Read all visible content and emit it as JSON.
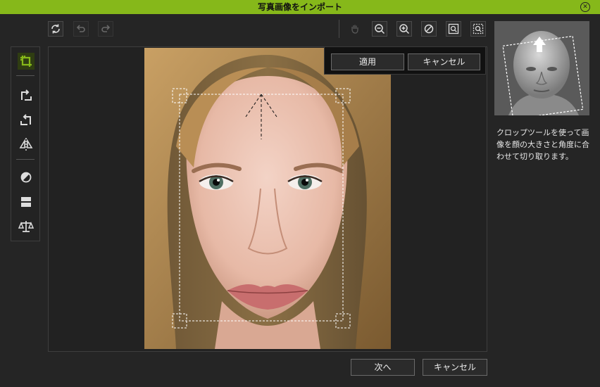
{
  "window": {
    "title": "写真画像をインポート",
    "close_icon": "close-icon"
  },
  "toolbar": {
    "left_icons": [
      "reset-icon",
      "undo-icon",
      "redo-icon"
    ],
    "right_icons": [
      "hand-pan-icon",
      "zoom-out-icon",
      "zoom-in-icon",
      "no-zoom-icon",
      "fit-view-icon",
      "actual-size-icon"
    ]
  },
  "left_tools": [
    "crop-icon",
    "rotate-right-icon",
    "rotate-left-icon",
    "flip-icon",
    "adjust-contrast-icon",
    "split-horizontal-icon",
    "balance-icon"
  ],
  "popup": {
    "apply_label": "適用",
    "cancel_label": "キャンセル"
  },
  "help_text": "クロップツールを使って画像を顔の大きさと角度に合わせて切り取ります。",
  "footer": {
    "next_label": "次へ",
    "cancel_label": "キャンセル"
  },
  "colors": {
    "accent": "#86b81a",
    "background": "#252525"
  }
}
